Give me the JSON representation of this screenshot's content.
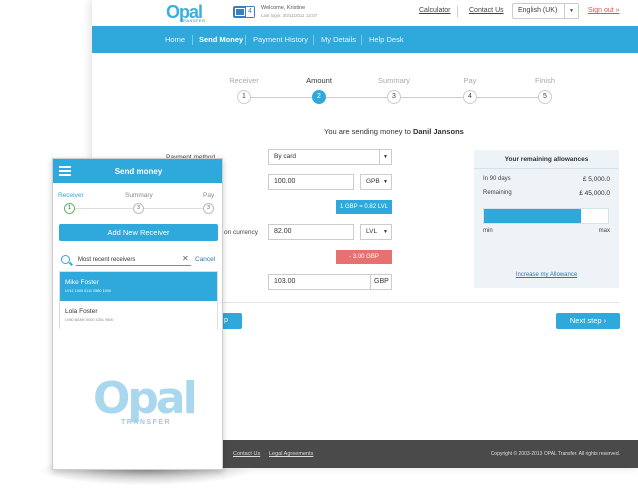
{
  "header": {
    "logo_text": "Opal",
    "logo_sub": "TRANSFER",
    "message_count": "4",
    "welcome": "Welcome, Kristine",
    "last_login": "Last login: 30/11/2011 13:07",
    "calculator": "Calculator",
    "contact_us": "Contact Us",
    "language": "English (UK)",
    "sign_out": "Sign out »"
  },
  "nav": {
    "items": [
      "Home",
      "Send Money",
      "Payment History",
      "My Details",
      "Help Desk"
    ],
    "active": "Send Money"
  },
  "steps": [
    {
      "label": "Receiver",
      "num": "1"
    },
    {
      "label": "Amount",
      "num": "2"
    },
    {
      "label": "Summary",
      "num": "3"
    },
    {
      "label": "Pay",
      "num": "4"
    },
    {
      "label": "Finish",
      "num": "5"
    }
  ],
  "sending": {
    "prefix": "You are sending money to",
    "name": "Danil Jansons"
  },
  "form": {
    "payment_method_label": "Payment method",
    "payment_method": "By card",
    "amount_value": "100.00",
    "amount_currency": "GPB",
    "rate": "1 GBP = 0.82 LVL",
    "receive_label": "on currency",
    "receive_value": "82.00",
    "receive_currency": "LVL",
    "fee": "- 3.00 GBP",
    "total_value": "103.00",
    "total_currency": "GBP"
  },
  "allowance": {
    "title": "Your remaining allowances",
    "rows": [
      {
        "key": "In 90 days",
        "value": "£ 5,000.0"
      },
      {
        "key": "Remaining",
        "value": "£ 45,000.0"
      }
    ],
    "fill_fraction": 0.78,
    "min": "min",
    "max": "max",
    "increase": "Increase my Allowance"
  },
  "buttons": {
    "prev": "p",
    "next": "Next step ›"
  },
  "footer": {
    "contact": "Contact Us",
    "legal": "Legal Agreements",
    "copyright": "Copyright © 2003-2013 OPAL Transfer. All rights reserved."
  },
  "phone": {
    "title": "Send money",
    "steps": [
      {
        "label": "Receiver",
        "num": "1"
      },
      {
        "label": "Summary",
        "num": "3"
      },
      {
        "label": "Pay",
        "num": "3"
      }
    ],
    "add_button": "Add New Receiver",
    "search_value": "Most recent receivers",
    "cancel": "Cancel",
    "receivers": [
      {
        "name": "Mike Foster",
        "account": "LV12 1000 0111 0580 1000"
      },
      {
        "name": "Lola Foster",
        "account": "LV80 BANK 0000 4351 9500"
      }
    ],
    "logo_text": "Opal",
    "logo_sub": "TRANSFER"
  }
}
